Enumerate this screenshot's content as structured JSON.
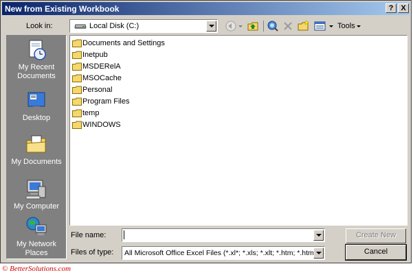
{
  "window": {
    "title": "New from Existing Workbook",
    "help_label": "?",
    "close_label": "X"
  },
  "lookin": {
    "label": "Look in:",
    "value": "Local Disk (C:)"
  },
  "toolbar": {
    "tools_label": "Tools"
  },
  "places": [
    {
      "label": "My Recent Documents"
    },
    {
      "label": "Desktop"
    },
    {
      "label": "My Documents"
    },
    {
      "label": "My Computer"
    },
    {
      "label": "My Network Places"
    }
  ],
  "files": [
    "Documents and Settings",
    "Inetpub",
    "MSDERelA",
    "MSOCache",
    "Personal",
    "Program Files",
    "temp",
    "WINDOWS"
  ],
  "filename": {
    "label": "File name:",
    "value": ""
  },
  "filetype": {
    "label": "Files of type:",
    "value": "All Microsoft Office Excel Files (*.xl*; *.xls; *.xlt; *.htm; *.html; *.mht; *.mhtml; *.xlc; *.xlm; *.xlw)"
  },
  "buttons": {
    "create": "Create New",
    "cancel": "Cancel"
  },
  "footer": {
    "copyright": "© BetterSolutions.com"
  },
  "colors": {
    "titlebar_start": "#0a246a",
    "titlebar_end": "#a6caf0",
    "dialog_bg": "#d4d0c8",
    "folder": "#f5d76e",
    "footer_text": "#cc0000"
  }
}
